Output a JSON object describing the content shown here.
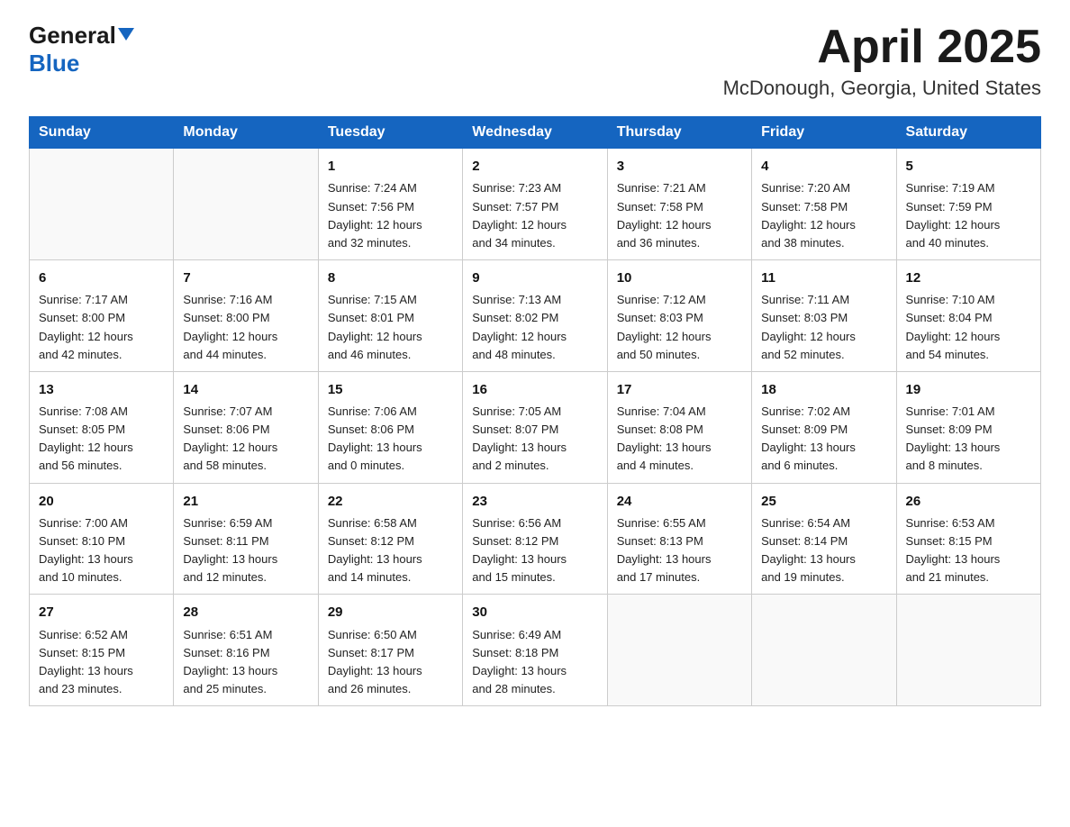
{
  "header": {
    "logo_general": "General",
    "logo_blue": "Blue",
    "month_title": "April 2025",
    "location": "McDonough, Georgia, United States"
  },
  "calendar": {
    "days_of_week": [
      "Sunday",
      "Monday",
      "Tuesday",
      "Wednesday",
      "Thursday",
      "Friday",
      "Saturday"
    ],
    "weeks": [
      [
        {
          "day": "",
          "info": ""
        },
        {
          "day": "",
          "info": ""
        },
        {
          "day": "1",
          "info": "Sunrise: 7:24 AM\nSunset: 7:56 PM\nDaylight: 12 hours\nand 32 minutes."
        },
        {
          "day": "2",
          "info": "Sunrise: 7:23 AM\nSunset: 7:57 PM\nDaylight: 12 hours\nand 34 minutes."
        },
        {
          "day": "3",
          "info": "Sunrise: 7:21 AM\nSunset: 7:58 PM\nDaylight: 12 hours\nand 36 minutes."
        },
        {
          "day": "4",
          "info": "Sunrise: 7:20 AM\nSunset: 7:58 PM\nDaylight: 12 hours\nand 38 minutes."
        },
        {
          "day": "5",
          "info": "Sunrise: 7:19 AM\nSunset: 7:59 PM\nDaylight: 12 hours\nand 40 minutes."
        }
      ],
      [
        {
          "day": "6",
          "info": "Sunrise: 7:17 AM\nSunset: 8:00 PM\nDaylight: 12 hours\nand 42 minutes."
        },
        {
          "day": "7",
          "info": "Sunrise: 7:16 AM\nSunset: 8:00 PM\nDaylight: 12 hours\nand 44 minutes."
        },
        {
          "day": "8",
          "info": "Sunrise: 7:15 AM\nSunset: 8:01 PM\nDaylight: 12 hours\nand 46 minutes."
        },
        {
          "day": "9",
          "info": "Sunrise: 7:13 AM\nSunset: 8:02 PM\nDaylight: 12 hours\nand 48 minutes."
        },
        {
          "day": "10",
          "info": "Sunrise: 7:12 AM\nSunset: 8:03 PM\nDaylight: 12 hours\nand 50 minutes."
        },
        {
          "day": "11",
          "info": "Sunrise: 7:11 AM\nSunset: 8:03 PM\nDaylight: 12 hours\nand 52 minutes."
        },
        {
          "day": "12",
          "info": "Sunrise: 7:10 AM\nSunset: 8:04 PM\nDaylight: 12 hours\nand 54 minutes."
        }
      ],
      [
        {
          "day": "13",
          "info": "Sunrise: 7:08 AM\nSunset: 8:05 PM\nDaylight: 12 hours\nand 56 minutes."
        },
        {
          "day": "14",
          "info": "Sunrise: 7:07 AM\nSunset: 8:06 PM\nDaylight: 12 hours\nand 58 minutes."
        },
        {
          "day": "15",
          "info": "Sunrise: 7:06 AM\nSunset: 8:06 PM\nDaylight: 13 hours\nand 0 minutes."
        },
        {
          "day": "16",
          "info": "Sunrise: 7:05 AM\nSunset: 8:07 PM\nDaylight: 13 hours\nand 2 minutes."
        },
        {
          "day": "17",
          "info": "Sunrise: 7:04 AM\nSunset: 8:08 PM\nDaylight: 13 hours\nand 4 minutes."
        },
        {
          "day": "18",
          "info": "Sunrise: 7:02 AM\nSunset: 8:09 PM\nDaylight: 13 hours\nand 6 minutes."
        },
        {
          "day": "19",
          "info": "Sunrise: 7:01 AM\nSunset: 8:09 PM\nDaylight: 13 hours\nand 8 minutes."
        }
      ],
      [
        {
          "day": "20",
          "info": "Sunrise: 7:00 AM\nSunset: 8:10 PM\nDaylight: 13 hours\nand 10 minutes."
        },
        {
          "day": "21",
          "info": "Sunrise: 6:59 AM\nSunset: 8:11 PM\nDaylight: 13 hours\nand 12 minutes."
        },
        {
          "day": "22",
          "info": "Sunrise: 6:58 AM\nSunset: 8:12 PM\nDaylight: 13 hours\nand 14 minutes."
        },
        {
          "day": "23",
          "info": "Sunrise: 6:56 AM\nSunset: 8:12 PM\nDaylight: 13 hours\nand 15 minutes."
        },
        {
          "day": "24",
          "info": "Sunrise: 6:55 AM\nSunset: 8:13 PM\nDaylight: 13 hours\nand 17 minutes."
        },
        {
          "day": "25",
          "info": "Sunrise: 6:54 AM\nSunset: 8:14 PM\nDaylight: 13 hours\nand 19 minutes."
        },
        {
          "day": "26",
          "info": "Sunrise: 6:53 AM\nSunset: 8:15 PM\nDaylight: 13 hours\nand 21 minutes."
        }
      ],
      [
        {
          "day": "27",
          "info": "Sunrise: 6:52 AM\nSunset: 8:15 PM\nDaylight: 13 hours\nand 23 minutes."
        },
        {
          "day": "28",
          "info": "Sunrise: 6:51 AM\nSunset: 8:16 PM\nDaylight: 13 hours\nand 25 minutes."
        },
        {
          "day": "29",
          "info": "Sunrise: 6:50 AM\nSunset: 8:17 PM\nDaylight: 13 hours\nand 26 minutes."
        },
        {
          "day": "30",
          "info": "Sunrise: 6:49 AM\nSunset: 8:18 PM\nDaylight: 13 hours\nand 28 minutes."
        },
        {
          "day": "",
          "info": ""
        },
        {
          "day": "",
          "info": ""
        },
        {
          "day": "",
          "info": ""
        }
      ]
    ]
  }
}
